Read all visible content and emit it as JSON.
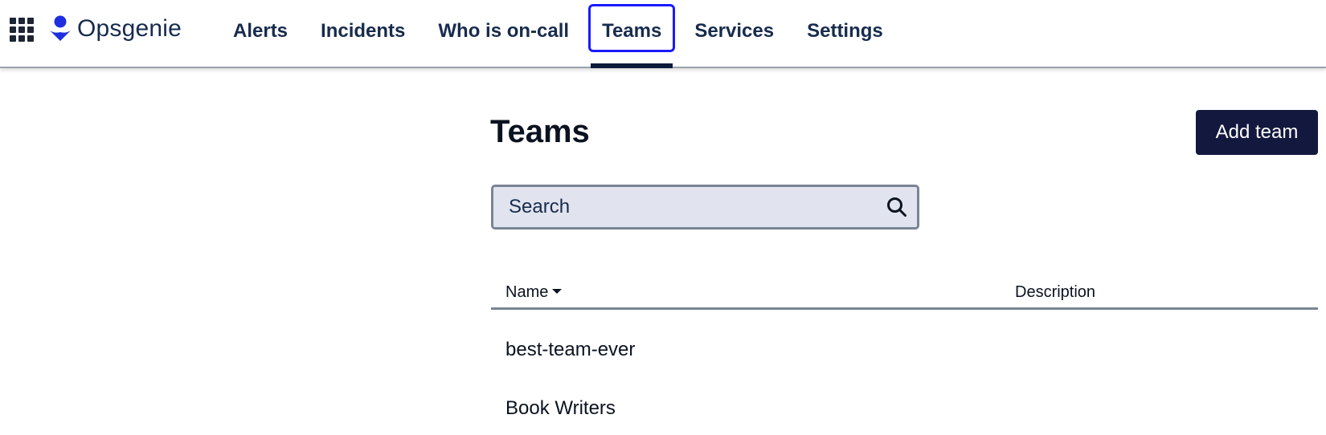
{
  "brand": {
    "name": "Opsgenie",
    "accent": "#1a1aff",
    "logo_color": "#1f2fe0"
  },
  "nav": {
    "items": [
      {
        "label": "Alerts"
      },
      {
        "label": "Incidents"
      },
      {
        "label": "Who is on-call"
      },
      {
        "label": "Teams",
        "active": true
      },
      {
        "label": "Services"
      },
      {
        "label": "Settings"
      }
    ]
  },
  "page": {
    "title": "Teams",
    "add_button_label": "Add team"
  },
  "search": {
    "placeholder": "Search",
    "value": ""
  },
  "table": {
    "columns": [
      {
        "label": "Name",
        "sort": "descending"
      },
      {
        "label": "Description"
      }
    ],
    "rows": [
      {
        "name": "best-team-ever",
        "description": ""
      },
      {
        "name": "Book Writers",
        "description": ""
      }
    ]
  },
  "icons": {
    "app_switcher": "grid-icon",
    "search": "search-icon",
    "sort": "caret-down-icon"
  }
}
